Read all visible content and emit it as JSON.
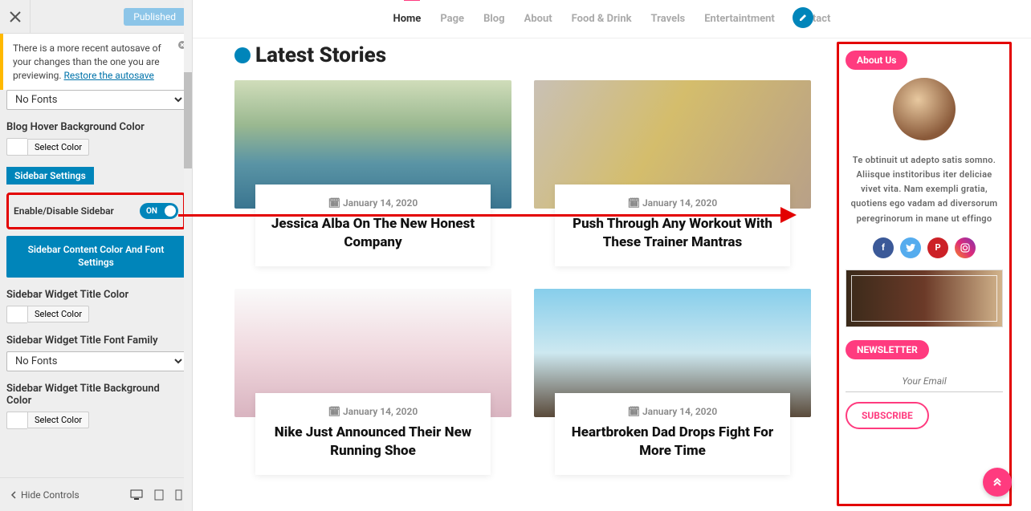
{
  "panel": {
    "published_label": "Published",
    "notice_text": "There is a more recent autosave of your changes than the one you are previewing. ",
    "notice_link": "Restore the autosave",
    "no_fonts": "No Fonts",
    "blog_hover_label": "Blog Hover Background Color",
    "select_color": "Select Color",
    "sidebar_settings": "Sidebar Settings",
    "enable_disable": "Enable/Disable Sidebar",
    "toggle_state": "ON",
    "content_color_font": "Sidebar Content Color And Font Settings",
    "widget_title_color": "Sidebar Widget Title Color",
    "widget_title_font": "Sidebar Widget Title Font Family",
    "widget_title_bg": "Sidebar Widget Title Background Color",
    "hide_controls": "Hide Controls"
  },
  "nav": {
    "items": [
      {
        "label": "Home",
        "active": true
      },
      {
        "label": "Page",
        "active": false
      },
      {
        "label": "Blog",
        "active": false
      },
      {
        "label": "About",
        "active": false
      },
      {
        "label": "Food & Drink",
        "active": false
      },
      {
        "label": "Travels",
        "active": false
      },
      {
        "label": "Entertaintment",
        "active": false
      },
      {
        "label": "Contact",
        "active": false
      }
    ]
  },
  "section_heading": "Latest Stories",
  "posts": [
    {
      "date": "January 14, 2020",
      "title": "Jessica Alba On The New Honest Company"
    },
    {
      "date": "January 14, 2020",
      "title": "Push Through Any Workout With These Trainer Mantras"
    },
    {
      "date": "January 14, 2020",
      "title": "Nike Just Announced Their New Running Shoe"
    },
    {
      "date": "January 14, 2020",
      "title": "Heartbroken Dad Drops Fight For More Time"
    }
  ],
  "sidebar": {
    "about_title": "About Us",
    "about_text": "Te obtinuit ut adepto satis somno. Aliisque institoribus iter deliciae vivet vita. Nam exempli gratia, quotiens ego vadam ad diversorum peregrinorum in mane ut effingo",
    "newsletter_title": "NEWSLETTER",
    "email_placeholder": "Your Email",
    "subscribe": "SUBSCRIBE"
  },
  "icons": {
    "calendar": "📅"
  }
}
